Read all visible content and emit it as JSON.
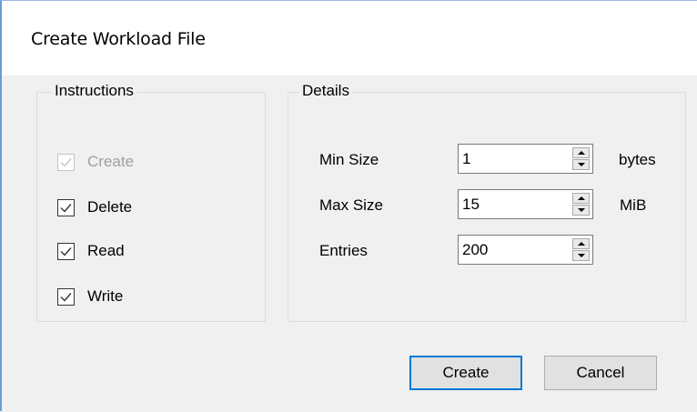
{
  "window": {
    "title": "Create Workload File"
  },
  "instructions": {
    "title": "Instructions",
    "items": [
      {
        "label": "Create",
        "checked": true,
        "enabled": false
      },
      {
        "label": "Delete",
        "checked": true,
        "enabled": true
      },
      {
        "label": "Read",
        "checked": true,
        "enabled": true
      },
      {
        "label": "Write",
        "checked": true,
        "enabled": true
      }
    ]
  },
  "details": {
    "title": "Details",
    "min_size": {
      "label": "Min Size",
      "value": "1",
      "unit": "bytes"
    },
    "max_size": {
      "label": "Max Size",
      "value": "15",
      "unit": "MiB"
    },
    "entries": {
      "label": "Entries",
      "value": "200"
    }
  },
  "buttons": {
    "create": "Create",
    "cancel": "Cancel"
  },
  "colors": {
    "accent": "#0078d7",
    "window_border": "#6b9bd8",
    "client_bg": "#f0f0f0"
  }
}
